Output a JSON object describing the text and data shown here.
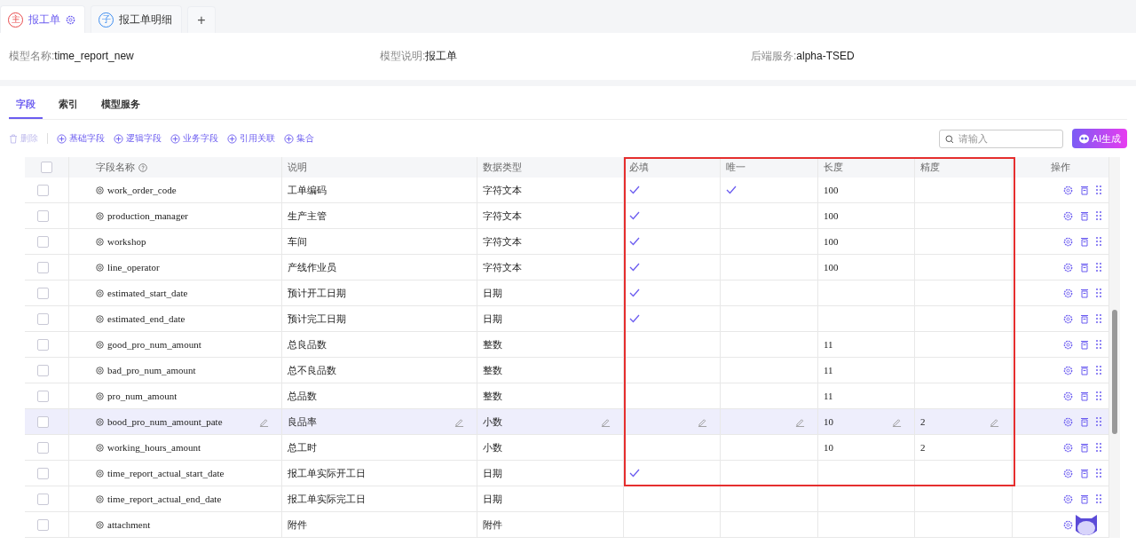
{
  "tabs": [
    {
      "badge": "主",
      "label": "报工单",
      "selected": true,
      "kind": "main"
    },
    {
      "badge": "子",
      "label": "报工单明细",
      "selected": false,
      "kind": "child"
    }
  ],
  "add_tab": "+",
  "info": [
    {
      "label": "模型名称:",
      "value": "time_report_new"
    },
    {
      "label": "模型说明:",
      "value": "报工单"
    },
    {
      "label": "后端服务:",
      "value": "alpha-TSED"
    }
  ],
  "sub_tabs": [
    {
      "label": "字段",
      "selected": true
    },
    {
      "label": "索引",
      "selected": false
    },
    {
      "label": "模型服务",
      "selected": false
    }
  ],
  "toolbar": {
    "delete": {
      "label": "删除",
      "disabled": true
    },
    "add_actions": [
      "基础字段",
      "逻辑字段",
      "业务字段",
      "引用关联",
      "集合"
    ]
  },
  "search": {
    "placeholder": "请输入"
  },
  "ai_button": "AI生成",
  "table": {
    "select_all": false,
    "columns": [
      "字段名称",
      "说明",
      "数据类型",
      "必填",
      "唯一",
      "长度",
      "精度",
      "操作"
    ],
    "rows": [
      {
        "checked": false,
        "selected": false,
        "name": "work_order_code",
        "desc": "工单编码",
        "type": "字符文本",
        "required": true,
        "unique": true,
        "length": "100",
        "precision": ""
      },
      {
        "checked": false,
        "selected": false,
        "name": "production_manager",
        "desc": "生产主管",
        "type": "字符文本",
        "required": true,
        "unique": false,
        "length": "100",
        "precision": ""
      },
      {
        "checked": false,
        "selected": false,
        "name": "workshop",
        "desc": "车间",
        "type": "字符文本",
        "required": true,
        "unique": false,
        "length": "100",
        "precision": ""
      },
      {
        "checked": false,
        "selected": false,
        "name": "line_operator",
        "desc": "产线作业员",
        "type": "字符文本",
        "required": true,
        "unique": false,
        "length": "100",
        "precision": ""
      },
      {
        "checked": false,
        "selected": false,
        "name": "estimated_start_date",
        "desc": "预计开工日期",
        "type": "日期",
        "required": true,
        "unique": false,
        "length": "",
        "precision": ""
      },
      {
        "checked": false,
        "selected": false,
        "name": "estimated_end_date",
        "desc": "预计完工日期",
        "type": "日期",
        "required": true,
        "unique": false,
        "length": "",
        "precision": ""
      },
      {
        "checked": false,
        "selected": false,
        "name": "good_pro_num_amount",
        "desc": "总良品数",
        "type": "整数",
        "required": false,
        "unique": false,
        "length": "11",
        "precision": ""
      },
      {
        "checked": false,
        "selected": false,
        "name": "bad_pro_num_amount",
        "desc": "总不良品数",
        "type": "整数",
        "required": false,
        "unique": false,
        "length": "11",
        "precision": ""
      },
      {
        "checked": false,
        "selected": false,
        "name": "pro_num_amount",
        "desc": "总品数",
        "type": "整数",
        "required": false,
        "unique": false,
        "length": "11",
        "precision": ""
      },
      {
        "checked": false,
        "selected": true,
        "name": "bood_pro_num_amount_pate",
        "desc": "良品率",
        "type": "小数",
        "required": false,
        "unique": false,
        "length": "10",
        "precision": "2"
      },
      {
        "checked": false,
        "selected": false,
        "name": "working_hours_amount",
        "desc": "总工时",
        "type": "小数",
        "required": false,
        "unique": false,
        "length": "10",
        "precision": "2"
      },
      {
        "checked": false,
        "selected": false,
        "name": "time_report_actual_start_date",
        "desc": "报工单实际开工日",
        "type": "日期",
        "required": true,
        "unique": false,
        "length": "",
        "precision": ""
      },
      {
        "checked": false,
        "selected": false,
        "name": "time_report_actual_end_date",
        "desc": "报工单实际完工日",
        "type": "日期",
        "required": false,
        "unique": false,
        "length": "",
        "precision": ""
      },
      {
        "checked": false,
        "selected": false,
        "name": "attachment",
        "desc": "附件",
        "type": "附件",
        "required": false,
        "unique": false,
        "length": "",
        "precision": ""
      }
    ]
  }
}
